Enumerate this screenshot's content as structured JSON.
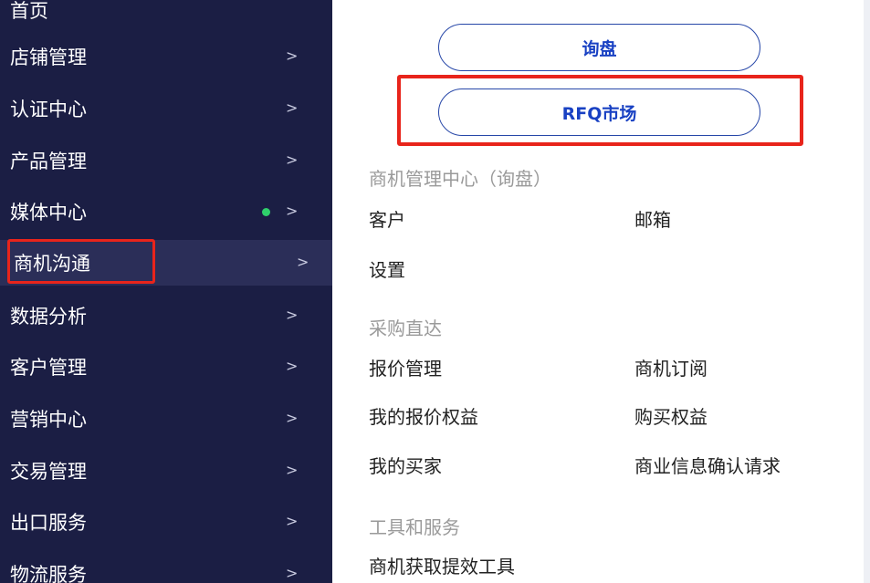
{
  "sidebar": {
    "items": [
      {
        "label": "首页"
      },
      {
        "label": "店铺管理",
        "chevron": ">"
      },
      {
        "label": "认证中心",
        "chevron": ">"
      },
      {
        "label": "产品管理",
        "chevron": ">"
      },
      {
        "label": "媒体中心",
        "chevron": ">"
      },
      {
        "label": "商机沟通",
        "chevron": ">"
      },
      {
        "label": "数据分析",
        "chevron": ">"
      },
      {
        "label": "客户管理",
        "chevron": ">"
      },
      {
        "label": "营销中心",
        "chevron": ">"
      },
      {
        "label": "交易管理",
        "chevron": ">"
      },
      {
        "label": "出口服务",
        "chevron": ">"
      },
      {
        "label": "物流服务",
        "chevron": ">"
      }
    ],
    "active_item": "商机沟通",
    "dot_color": "#2fd06b"
  },
  "panel": {
    "buttons": {
      "inquiry": "询盘",
      "rfq": "RFQ市场"
    },
    "sections": [
      {
        "title": "商机管理中心（询盘）",
        "links": [
          "客户",
          "邮箱",
          "设置"
        ]
      },
      {
        "title": "采购直达",
        "links": [
          "报价管理",
          "商机订阅",
          "我的报价权益",
          "购买权益",
          "我的买家",
          "商业信息确认请求"
        ]
      },
      {
        "title": "工具和服务",
        "links": [
          "商机获取提效工具"
        ]
      }
    ]
  },
  "colors": {
    "sidebar_bg": "#1b1e44",
    "highlight_red": "#e8241b",
    "button_text_blue": "#1941c3"
  }
}
